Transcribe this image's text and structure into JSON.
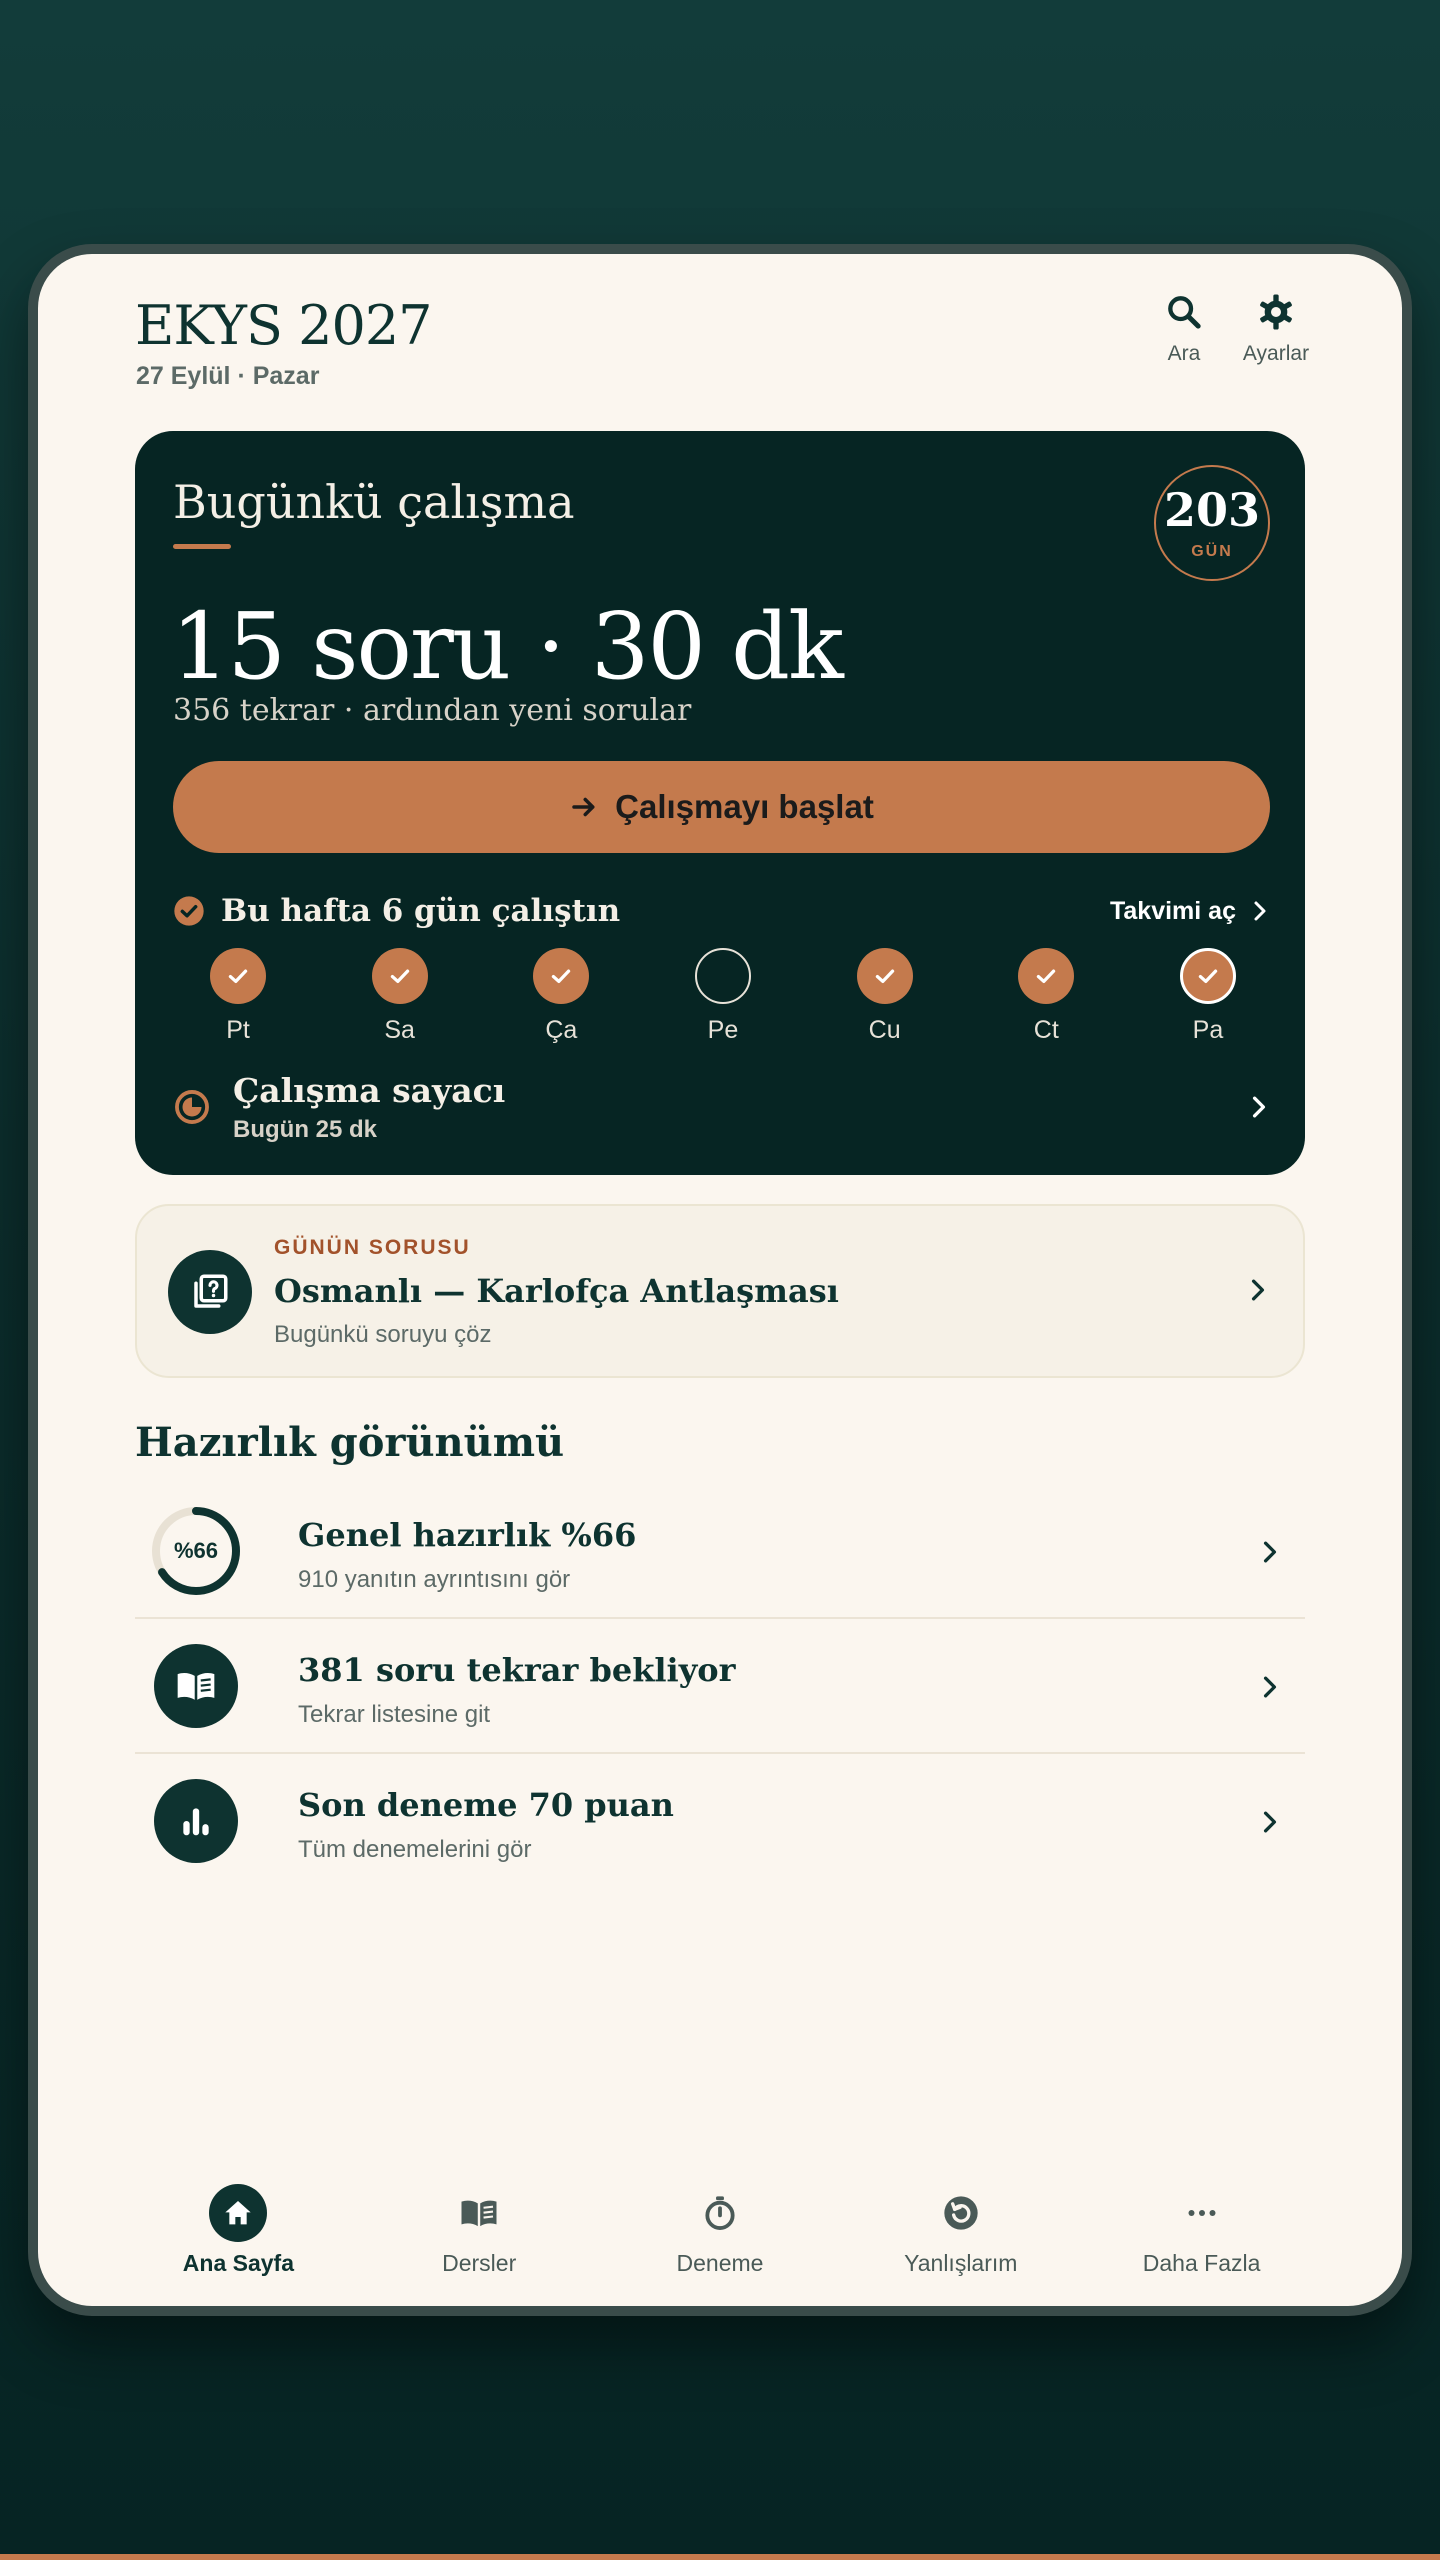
{
  "header": {
    "title": "EKYS 2027",
    "date": "27 Eylül · Pazar",
    "search_label": "Ara",
    "settings_label": "Ayarlar"
  },
  "hero": {
    "title": "Bugünkü çalışma",
    "days_left": "203",
    "days_unit": "GÜN",
    "headline": "15 soru · 30 dk",
    "subline": "356 tekrar · ardından yeni sorular",
    "cta_label": "Çalışmayı başlat",
    "week_text": "Bu hafta 6 gün çalıştın",
    "calendar_label": "Takvimi aç",
    "days": [
      {
        "label": "Pt",
        "done": true
      },
      {
        "label": "Sa",
        "done": true
      },
      {
        "label": "Ça",
        "done": true
      },
      {
        "label": "Pe",
        "done": false
      },
      {
        "label": "Cu",
        "done": true
      },
      {
        "label": "Ct",
        "done": true
      },
      {
        "label": "Pa",
        "done": true,
        "today": true
      }
    ],
    "timer_title": "Çalışma sayacı",
    "timer_sub": "Bugün 25 dk"
  },
  "question": {
    "kicker": "GÜNÜN SORUSU",
    "title": "Osmanlı — Karlofça Antlaşması",
    "subtitle": "Bugünkü soruyu çöz"
  },
  "readiness": {
    "title": "Hazırlık görünümü",
    "overall_percent": 66,
    "overall_ring_label": "%66",
    "items": [
      {
        "title": "Genel hazırlık %66",
        "subtitle": "910 yanıtın ayrıntısını gör"
      },
      {
        "title": "381 soru tekrar bekliyor",
        "subtitle": "Tekrar listesine git"
      },
      {
        "title": "Son deneme 70 puan",
        "subtitle": "Tüm denemelerini gör"
      }
    ]
  },
  "nav": {
    "items": [
      {
        "label": "Ana Sayfa",
        "icon": "home-icon",
        "active": true
      },
      {
        "label": "Dersler",
        "icon": "book-icon"
      },
      {
        "label": "Deneme",
        "icon": "stopwatch-icon"
      },
      {
        "label": "Yanlışlarım",
        "icon": "retry-icon"
      },
      {
        "label": "Daha Fazla",
        "icon": "more-icon"
      }
    ]
  },
  "colors": {
    "accent": "#c47a4d",
    "primary": "#0e3330",
    "hero_bg": "#062523",
    "surface": "#fbf6ef"
  }
}
